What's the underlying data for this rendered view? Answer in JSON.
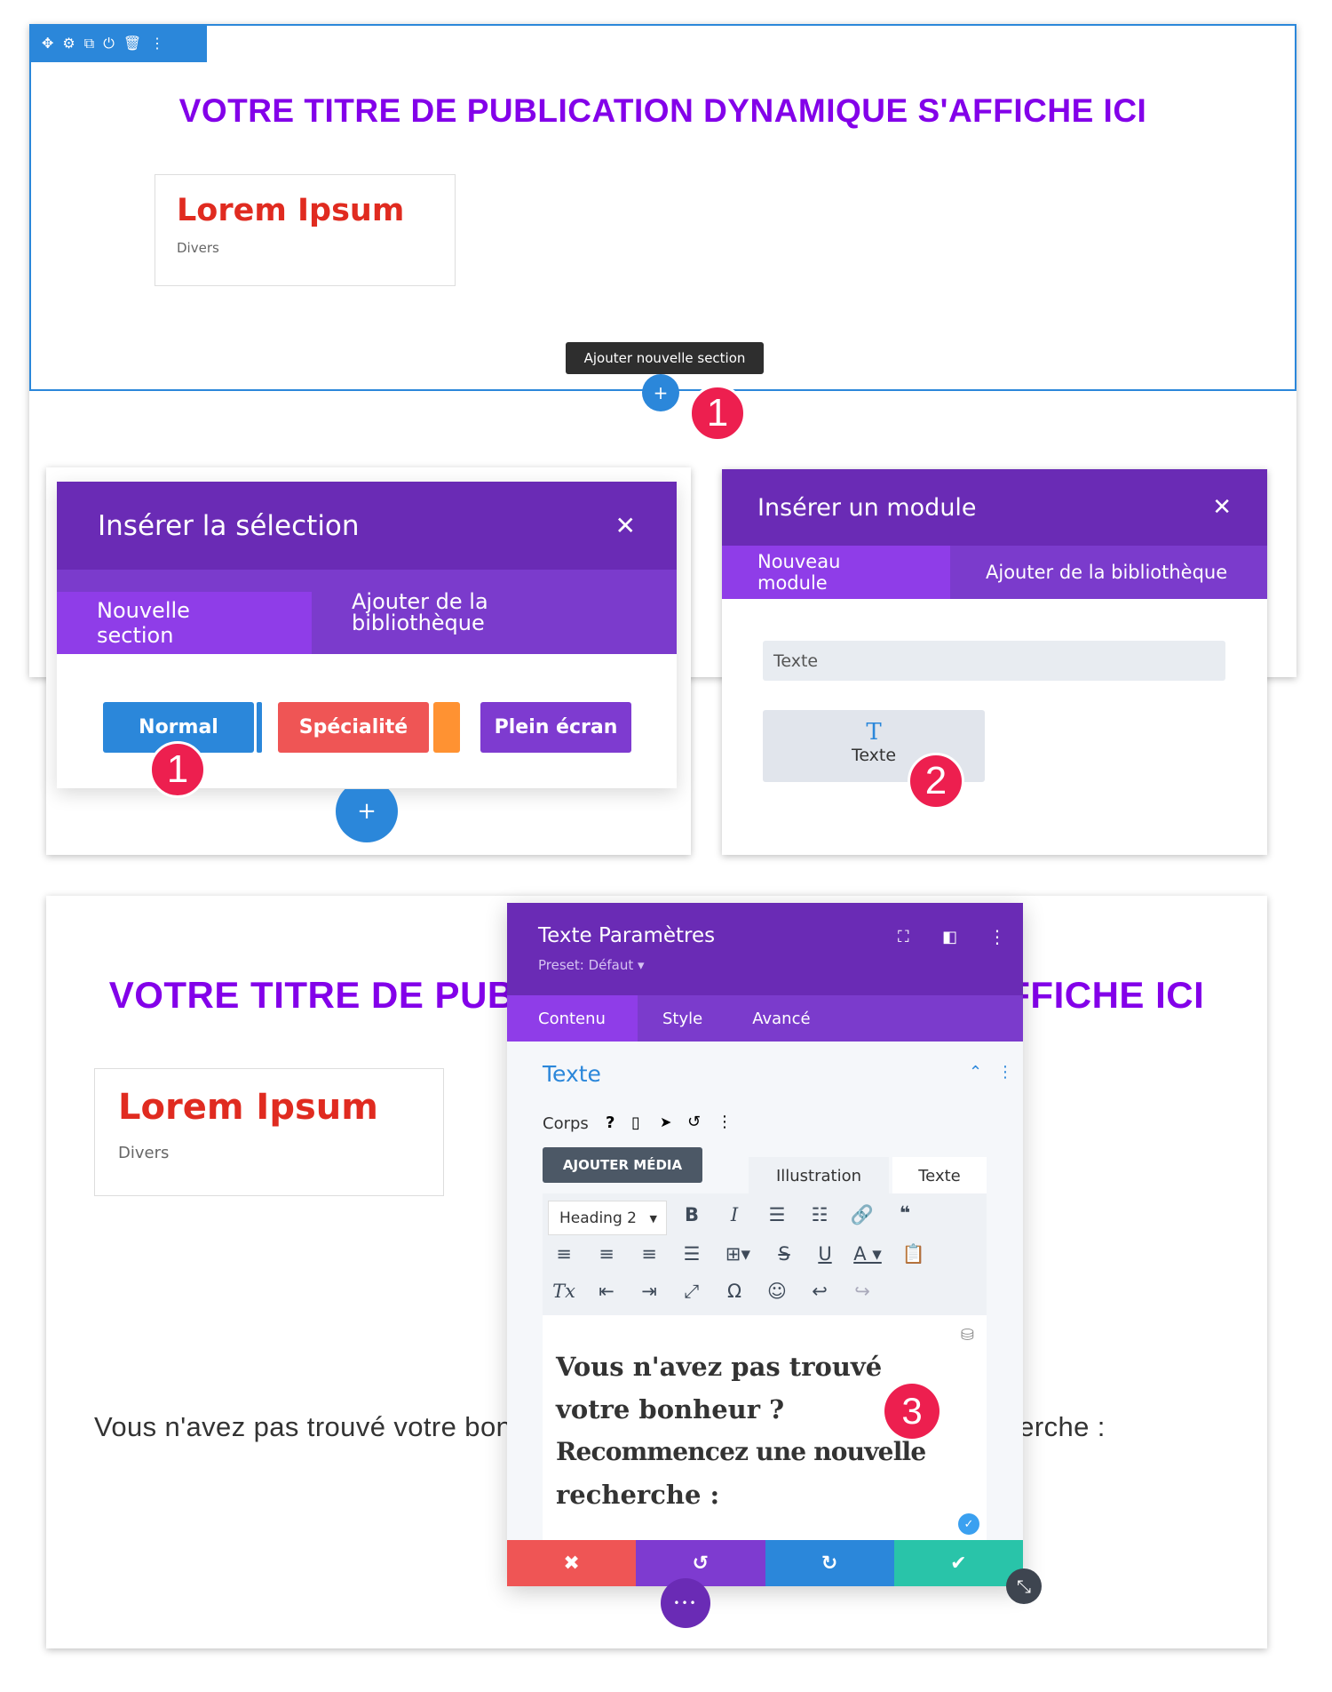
{
  "top_section": {
    "toolbar_icons": [
      "move-icon",
      "gear-icon",
      "duplicate-icon",
      "power-icon",
      "trash-icon",
      "more-vertical-icon"
    ],
    "title": "VOTRE TITRE DE PUBLICATION DYNAMIQUE S'AFFICHE ICI",
    "card": {
      "title": "Lorem Ipsum",
      "category": "Divers"
    },
    "tooltip": "Ajouter nouvelle section",
    "add_button": "+",
    "badge": "1"
  },
  "insert_section": {
    "title": "Insérer la sélection",
    "close": "✕",
    "tabs": [
      {
        "label": "Nouvelle section",
        "active": true
      },
      {
        "label": "Ajouter de la bibliothèque",
        "active": false
      }
    ],
    "buttons": [
      {
        "label": "Normal",
        "color": "#2b87da"
      },
      {
        "label": "Spécialité",
        "color": "#ef5555"
      },
      {
        "label": "Plein écran",
        "color": "#7e3bd0"
      }
    ],
    "badge": "1",
    "add": "+"
  },
  "insert_module": {
    "title": "Insérer un module",
    "close": "✕",
    "tabs": [
      {
        "label": "Nouveau module",
        "active": true
      },
      {
        "label": "Ajouter de la bibliothèque",
        "active": false
      }
    ],
    "search_value": "Texte",
    "module": {
      "icon": "T",
      "label": "Texte"
    },
    "badge": "2"
  },
  "bottom_section": {
    "title": "VOTRE TITRE DE PUBLICATION DYNAMIQUE S'AFFICHE ICI",
    "card": {
      "title": "Lorem Ipsum",
      "category": "Divers"
    },
    "paragraph": "Vous n'avez pas trouvé votre bonheur ? Recommencez une nouvelle recherche :"
  },
  "settings": {
    "title": "Texte Paramètres",
    "preset": "Preset: Défaut ▾",
    "tabs": [
      {
        "label": "Contenu",
        "active": true
      },
      {
        "label": "Style"
      },
      {
        "label": "Avancé"
      }
    ],
    "group_title": "Texte",
    "field_label": "Corps",
    "add_media": "AJOUTER MÉDIA",
    "editor_tabs": [
      "Illustration",
      "Texte"
    ],
    "format_select": "Heading 2",
    "content_lines": [
      "Vous n'avez pas trouvé",
      "votre bonheur ?",
      "Recommencez une nouvelle",
      "recherche :"
    ],
    "badge": "3",
    "footer": [
      "cancel",
      "undo",
      "redo",
      "save"
    ],
    "more": "•••"
  },
  "colors": {
    "purple_header": "#6a2bb5",
    "title_purple": "#8300e9",
    "lorem_red": "#e02b20",
    "divi_blue": "#2b87da",
    "badge": "#ed1f4f",
    "green": "#29c4a9"
  }
}
